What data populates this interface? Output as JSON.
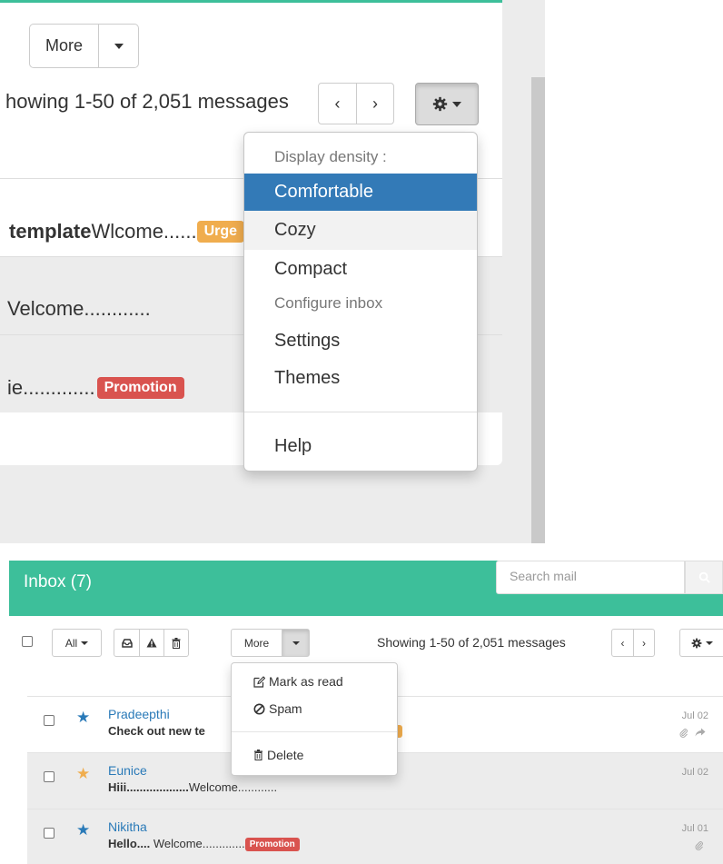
{
  "top_panel": {
    "more_button_label": "More",
    "showing_text": "howing 1-50 of 2,051 messages",
    "pager_prev": "‹",
    "pager_next": "›",
    "rows": [
      {
        "bold": "template",
        "text": "Wlcome......",
        "label": "Urge",
        "label_color": "#f0ad4e"
      },
      {
        "bold": "",
        "text": "Velcome............",
        "label": "",
        "label_color": ""
      },
      {
        "bold": "",
        "text": "ie.............",
        "label": "Promotion",
        "label_color": "#d9534f"
      }
    ],
    "settings_menu": {
      "header": "Display density :",
      "items": [
        "Comfortable",
        "Cozy",
        "Compact"
      ],
      "active_item": "Comfortable",
      "configure_header": "Configure inbox",
      "config_items": [
        "Settings",
        "Themes"
      ],
      "help": "Help"
    }
  },
  "bottom_panel": {
    "title": "Inbox (7)",
    "search": {
      "placeholder": "Search mail"
    },
    "toolbar": {
      "all_label": "All",
      "more_label": "More",
      "showing_text": "Showing 1-50 of 2,051 messages",
      "prev": "‹",
      "next": "›"
    },
    "more_menu": {
      "items": [
        "Mark as read",
        "Spam"
      ],
      "delete": "Delete"
    },
    "messages": [
      {
        "sender": "Pradeepthi",
        "subject_bold": "Check out new te",
        "subject": "",
        "label": "",
        "date": "Jul 02",
        "starred": "blue",
        "icons": [
          "paperclip-icon",
          "forward-icon"
        ]
      },
      {
        "sender": "Eunice",
        "subject_bold": "Hiii...................",
        "subject": "Welcome............",
        "label": "",
        "date": "Jul 02",
        "starred": "gold",
        "icons": []
      },
      {
        "sender": "Nikitha",
        "subject_bold": "Hello....",
        "subject": " Welcome.............",
        "label": "Promotion",
        "date": "Jul 01",
        "starred": "blue",
        "icons": [
          "paperclip-icon"
        ]
      }
    ],
    "colors": {
      "header": "#3dbf9a",
      "link": "#2a7ab8",
      "star_blue": "#2a7ab8",
      "star_gold": "#f0ad4e",
      "promotion": "#d9534f",
      "urgent": "#f0ad4e"
    }
  }
}
